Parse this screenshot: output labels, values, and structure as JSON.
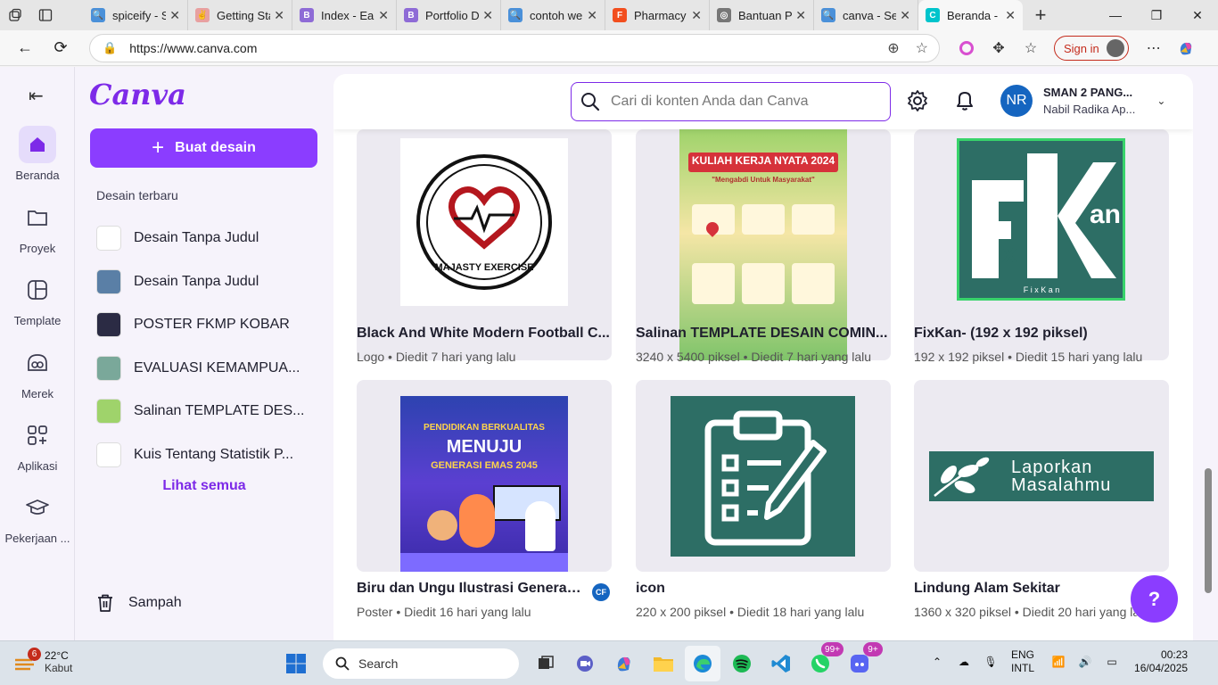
{
  "browser": {
    "tabs": [
      {
        "title": "spiceify - S",
        "color": "#4a90d9",
        "glyph": "🔍"
      },
      {
        "title": "Getting Sta",
        "color": "#e8a0a0",
        "glyph": "✌"
      },
      {
        "title": "Index - Ea",
        "color": "#8e6bd6",
        "glyph": "B"
      },
      {
        "title": "Portfolio D",
        "color": "#8e6bd6",
        "glyph": "B"
      },
      {
        "title": "contoh we",
        "color": "#4a90d9",
        "glyph": "🔍"
      },
      {
        "title": "Pharmacy",
        "color": "#f24e1e",
        "glyph": "F"
      },
      {
        "title": "Bantuan P",
        "color": "#777777",
        "glyph": "◎"
      },
      {
        "title": "canva - Se",
        "color": "#4a90d9",
        "glyph": "🔍"
      },
      {
        "title": "Beranda -",
        "color": "#00c4cc",
        "glyph": "C"
      }
    ],
    "url": "https://www.canva.com",
    "signin_label": "Sign in"
  },
  "canva": {
    "logo": "Canva",
    "rail": [
      {
        "label": "Beranda",
        "icon": "home-icon"
      },
      {
        "label": "Proyek",
        "icon": "folder-icon"
      },
      {
        "label": "Template",
        "icon": "template-icon"
      },
      {
        "label": "Merek",
        "icon": "brand-icon"
      },
      {
        "label": "Aplikasi",
        "icon": "apps-icon"
      },
      {
        "label": "Pekerjaan ...",
        "icon": "graduation-cap-icon"
      }
    ],
    "create_label": "Buat desain",
    "recent_heading": "Desain terbaru",
    "recent": [
      {
        "title": "Desain Tanpa Judul",
        "thumb": "#ffffff"
      },
      {
        "title": "Desain Tanpa Judul",
        "thumb": "#5a7fa6"
      },
      {
        "title": "POSTER FKMP KOBAR",
        "thumb": "#2b2b44"
      },
      {
        "title": "EVALUASI KEMAMPUA...",
        "thumb": "#7aa89a"
      },
      {
        "title": "Salinan TEMPLATE DES...",
        "thumb": "#9fd36b"
      },
      {
        "title": "Kuis Tentang Statistik P...",
        "thumb": "#ffffff"
      }
    ],
    "see_all": "Lihat semua",
    "trash": "Sampah",
    "search_placeholder": "Cari di konten Anda dan Canva",
    "account": {
      "initials": "NR",
      "org": "SMAN 2 PANG...",
      "name": "Nabil Radika Ap..."
    },
    "designs": [
      {
        "title": "Black And White Modern Football C...",
        "meta": "Logo • Diedit 7 hari yang lalu",
        "art_text": "MAJASTY EXERCISE"
      },
      {
        "title": "Salinan TEMPLATE DESAIN COMIN...",
        "meta": "3240 x 5400 piksel • Diedit 7 hari yang lalu",
        "art_text": "KULIAH KERJA NYATA 2024",
        "art_sub": "\"Mengabdi Untuk Masyarakat\""
      },
      {
        "title": "FixKan- (192 x 192 piksel)",
        "meta": "192 x 192 piksel • Diedit 15 hari yang lalu",
        "art_text": "F i x   K a n"
      },
      {
        "title": "Biru dan Ungu Ilustrasi Generasi...",
        "meta": "Poster • Diedit 16 hari yang lalu",
        "art_text": "PENDIDIKAN BERKUALITAS",
        "art_sub": "MENUJU",
        "art_sub2": "GENERASI EMAS 2045",
        "badge": "CF"
      },
      {
        "title": "icon",
        "meta": "220 x 200 piksel • Diedit 18 hari yang lalu"
      },
      {
        "title": "Lindung Alam Sekitar",
        "meta": "1360 x 320 piksel • Diedit 20 hari yang lalu",
        "art_text": "Laporkan",
        "art_sub": "Masalahmu"
      }
    ],
    "help_label": "?"
  },
  "taskbar": {
    "weather_temp": "22°C",
    "weather_desc": "Kabut",
    "weather_badge": "6",
    "search_label": "Search",
    "whatsapp_badge": "99+",
    "discord_badge": "9+",
    "lang1": "ENG",
    "lang2": "INTL",
    "time": "00:23",
    "date": "16/04/2025"
  },
  "colors": {
    "accent": "#8b3dff",
    "brand": "#7d2ae8",
    "teal": "#2d6e65"
  }
}
